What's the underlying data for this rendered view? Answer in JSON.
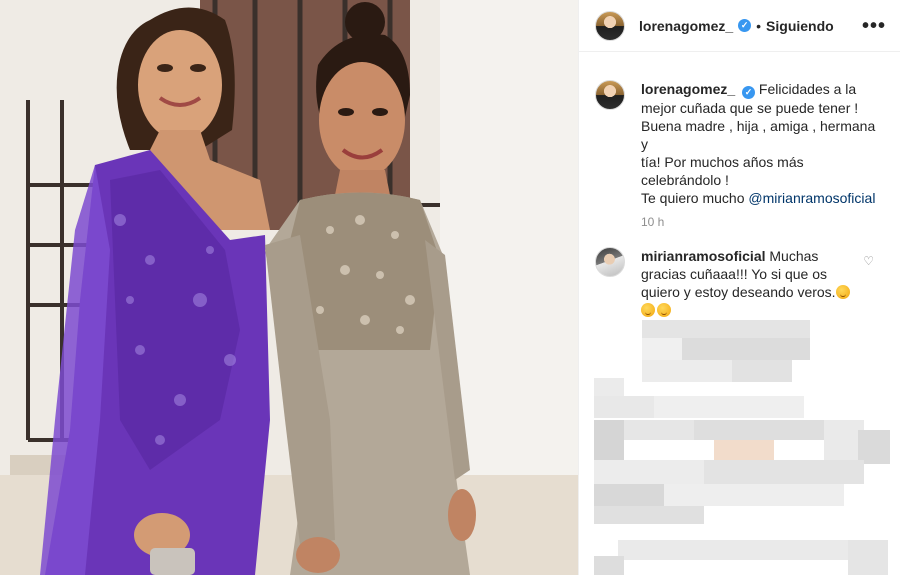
{
  "post": {
    "author": "lorenagomez_",
    "follow_status": "Siguiendo",
    "dot": "•",
    "more": "•••",
    "verified_mark": "✓",
    "caption": {
      "author": "lorenagomez_",
      "text": "Felicidades a la\nmejor cuñada que se puede tener !\nBuena madre , hija , amiga , hermana y\ntía! Por muchos años más\ncelebrándolo !\nTe quiero mucho ",
      "mention": "@mirianramosoficial"
    },
    "time": "10 h",
    "comments": [
      {
        "author": "mirianramosoficial",
        "text": "Muchas\ngracias cuñaaa!!! Yo si que os\nquiero y estoy deseando veros.",
        "like_icon": "heart-icon"
      }
    ]
  },
  "colors": {
    "accent_verified": "#3897f0",
    "mention": "#003569",
    "muted": "#8e8e8e",
    "purple_dress": "#6a35b8",
    "beige_dress": "#b3a898"
  }
}
